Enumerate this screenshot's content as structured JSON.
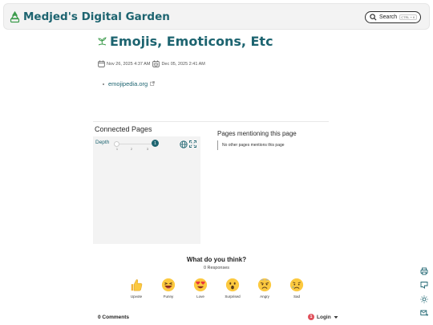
{
  "header": {
    "site_title": "Medjed's Digital Garden",
    "search_label": "Search",
    "search_shortcut": "CTRL + K"
  },
  "page": {
    "title": "Emojis, Emoticons, Etc",
    "created_date": "Nov 26, 2025 4:37 AM",
    "updated_date": "Dec 05, 2025 2:41 AM",
    "links": [
      "emojipedia.org"
    ]
  },
  "graph": {
    "title": "Connected Pages",
    "depth_label": "Depth",
    "depth_value": "1",
    "depth_ticks": [
      "1",
      "2",
      "3"
    ]
  },
  "mentions": {
    "title": "Pages mentioning this page",
    "empty_text": "No other pages mentions this page"
  },
  "feedback": {
    "question": "What do you think?",
    "responses": "0 Responses",
    "reactions": [
      {
        "label": "Upvote",
        "icon": "thumbs-up-icon"
      },
      {
        "label": "Funny",
        "icon": "laughing-face-icon"
      },
      {
        "label": "Love",
        "icon": "heart-eyes-face-icon"
      },
      {
        "label": "Surprised",
        "icon": "surprised-face-icon"
      },
      {
        "label": "Angry",
        "icon": "angry-face-icon"
      },
      {
        "label": "Sad",
        "icon": "sad-face-icon"
      }
    ]
  },
  "comments": {
    "count_label": "0 Comments",
    "login_label": "Login",
    "notification_count": "1"
  },
  "colors": {
    "accent": "#1d6470",
    "header_bg": "#f3f3f3",
    "graph_bg": "#f3f3f3"
  }
}
